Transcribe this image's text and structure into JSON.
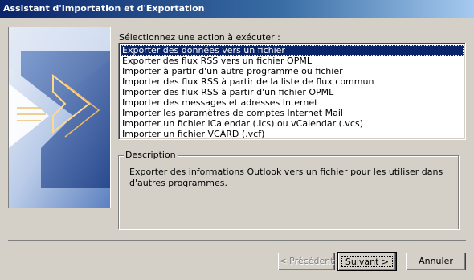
{
  "window": {
    "title": "Assistant d'Importation et d'Exportation"
  },
  "prompt": "Sélectionnez une action à exécuter :",
  "actions": [
    "Exporter des données vers un fichier",
    "Exporter des flux RSS vers un fichier OPML",
    "Importer à partir d'un autre programme ou fichier",
    "Importer des flux RSS à partir de la liste de flux commun",
    "Importer des flux RSS à partir d'un fichier OPML",
    "Importer des messages et adresses Internet",
    "Importer les paramètres de comptes Internet Mail",
    "Importer un fichier iCalendar (.ics) ou vCalendar (.vcs)",
    "Importer un fichier VCARD (.vcf)"
  ],
  "selected_action": "Exporter des données vers un fichier",
  "description": {
    "label": "Description",
    "text": "Exporter des informations Outlook vers un fichier pour les utiliser dans d'autres programmes."
  },
  "buttons": {
    "previous": "< Précédent",
    "next": "Suivant >",
    "cancel": "Annuler"
  },
  "colors": {
    "title_bar": "#0a246a",
    "selection": "#0a246a",
    "dialog_background": "#d4d0c8"
  }
}
